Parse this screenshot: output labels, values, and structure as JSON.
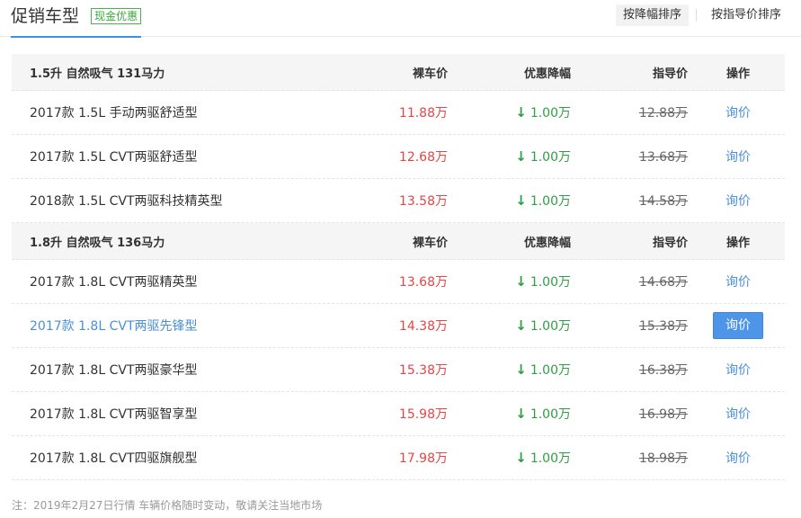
{
  "header": {
    "title": "促销车型",
    "badge": "现金优惠",
    "sort_by_discount": "按降幅排序",
    "sort_by_guide": "按指导价排序"
  },
  "columns": {
    "price": "裸车价",
    "discount": "优惠降幅",
    "guide": "指导价",
    "action": "操作"
  },
  "groups": [
    {
      "title": "1.5升 自然吸气 131马力",
      "rows": [
        {
          "name": "2017款 1.5L 手动两驱舒适型",
          "price": "11.88万",
          "arrow": "↓",
          "discount": "1.00万",
          "guide": "12.88万",
          "action": "询价"
        },
        {
          "name": "2017款 1.5L CVT两驱舒适型",
          "price": "12.68万",
          "arrow": "↓",
          "discount": "1.00万",
          "guide": "13.68万",
          "action": "询价"
        },
        {
          "name": "2018款 1.5L CVT两驱科技精英型",
          "price": "13.58万",
          "arrow": "↓",
          "discount": "1.00万",
          "guide": "14.58万",
          "action": "询价"
        }
      ]
    },
    {
      "title": "1.8升 自然吸气 136马力",
      "rows": [
        {
          "name": "2017款 1.8L CVT两驱精英型",
          "price": "13.68万",
          "arrow": "↓",
          "discount": "1.00万",
          "guide": "14.68万",
          "action": "询价"
        },
        {
          "name": "2017款 1.8L CVT两驱先锋型",
          "price": "14.38万",
          "arrow": "↓",
          "discount": "1.00万",
          "guide": "15.38万",
          "action": "询价",
          "highlight": true
        },
        {
          "name": "2017款 1.8L CVT两驱豪华型",
          "price": "15.38万",
          "arrow": "↓",
          "discount": "1.00万",
          "guide": "16.38万",
          "action": "询价"
        },
        {
          "name": "2017款 1.8L CVT两驱智享型",
          "price": "15.98万",
          "arrow": "↓",
          "discount": "1.00万",
          "guide": "16.98万",
          "action": "询价"
        },
        {
          "name": "2017款 1.8L CVT四驱旗舰型",
          "price": "17.98万",
          "arrow": "↓",
          "discount": "1.00万",
          "guide": "18.98万",
          "action": "询价"
        }
      ]
    }
  ],
  "note": "注：2019年2月27日行情 车辆价格随时变动，敬请关注当地市场",
  "colors": {
    "accent": "#4a90d9",
    "price": "#e64545",
    "discount": "#2e9e45",
    "badge": "#3aa83a"
  }
}
